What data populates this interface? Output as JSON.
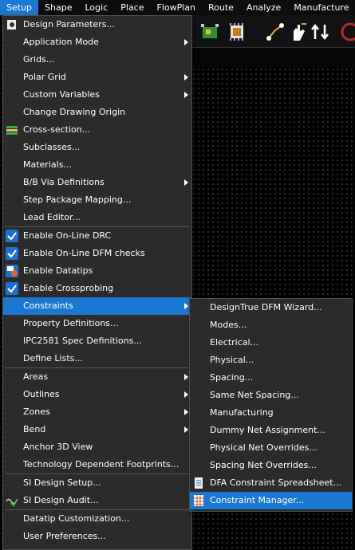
{
  "menubar": {
    "items": [
      "Setup",
      "Shape",
      "Logic",
      "Place",
      "FlowPlan",
      "Route",
      "Analyze",
      "Manufacture"
    ]
  },
  "toolbar": {
    "icons": [
      "chip-placement-icon",
      "gear-chip-icon",
      "route-connect-icon",
      "hand-push-icon",
      "swap-arrows-icon",
      "record-icon"
    ]
  },
  "setup_menu": {
    "items": [
      {
        "label": "Design Parameters..."
      },
      {
        "label": "Application Mode"
      },
      {
        "label": "Grids..."
      },
      {
        "label": "Polar Grid"
      },
      {
        "label": "Custom Variables"
      },
      {
        "label": "Change Drawing Origin"
      },
      {
        "label": "Cross-section..."
      },
      {
        "label": "Subclasses..."
      },
      {
        "label": "Materials..."
      },
      {
        "label": "B/B Via Definitions"
      },
      {
        "label": "Step Package Mapping..."
      },
      {
        "label": "Lead Editor..."
      },
      {
        "label": "Enable On-Line DRC"
      },
      {
        "label": "Enable On-Line DFM checks"
      },
      {
        "label": "Enable Datatips"
      },
      {
        "label": "Enable Crossprobing"
      },
      {
        "label": "Constraints"
      },
      {
        "label": "Property Definitions..."
      },
      {
        "label": "IPC2581 Spec Definitions..."
      },
      {
        "label": "Define Lists..."
      },
      {
        "label": "Areas"
      },
      {
        "label": "Outlines"
      },
      {
        "label": "Zones"
      },
      {
        "label": "Bend"
      },
      {
        "label": "Anchor 3D View"
      },
      {
        "label": "Technology Dependent Footprints..."
      },
      {
        "label": "SI Design Setup..."
      },
      {
        "label": "SI Design Audit..."
      },
      {
        "label": "Datatip Customization..."
      },
      {
        "label": "User Preferences..."
      }
    ]
  },
  "constraints_submenu": {
    "items": [
      {
        "label": "DesignTrue DFM Wizard..."
      },
      {
        "label": "Modes..."
      },
      {
        "label": "Electrical..."
      },
      {
        "label": "Physical..."
      },
      {
        "label": "Spacing..."
      },
      {
        "label": "Same Net Spacing..."
      },
      {
        "label": "Manufacturing"
      },
      {
        "label": "Dummy Net Assignment..."
      },
      {
        "label": "Physical Net Overrides..."
      },
      {
        "label": "Spacing Net Overrides..."
      },
      {
        "label": "DFA Constraint Spreadsheet..."
      },
      {
        "label": "Constraint Manager..."
      }
    ]
  },
  "colors": {
    "highlight": "#1b78d0",
    "menu_bg": "#2b2b2b",
    "checkbox": "#1a6fd1"
  }
}
